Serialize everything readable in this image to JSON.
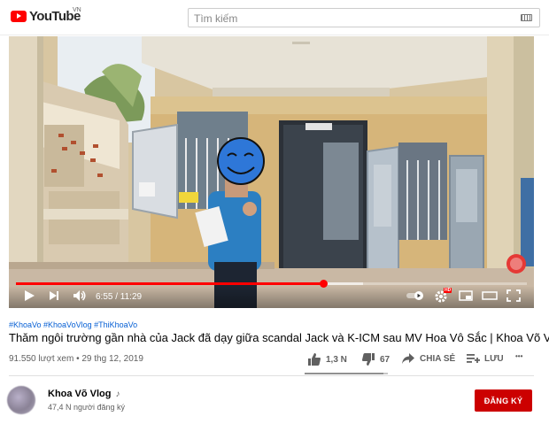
{
  "header": {
    "logo_text": "YouTube",
    "region": "VN",
    "search_placeholder": "Tìm kiếm"
  },
  "player": {
    "current_time": "6:55",
    "duration": "11:29",
    "time_display": "6:55 / 11:29",
    "played_fraction": 0.603,
    "loaded_fraction": 0.68,
    "hd_badge": "HD",
    "colors": {
      "progress": "#ff0000",
      "hd_badge": "#ff0000"
    }
  },
  "video": {
    "hashtags": "#KhoaVo #KhoaVoVlog #ThiKhoaVo",
    "title": "Thăm ngôi trường gần nhà của Jack đã dạy giữa scandal Jack và K-ICM sau MV Hoa Vô Sắc | Khoa Võ Vlog",
    "views": "91.550 lượt xem",
    "date": "29 thg 12, 2019",
    "meta_separator": "•",
    "likes": "1,3 N",
    "dislikes": "67",
    "like_fraction": 0.95,
    "share_label": "CHIA SẺ",
    "save_label": "LƯU",
    "more_label": "•••"
  },
  "channel": {
    "name": "Khoa Võ Vlog",
    "note_icon": "♪",
    "subscribers": "47,4 N người đăng ký",
    "subscribe_label": "ĐĂNG KÝ",
    "subscribe_color": "#cc0000"
  }
}
